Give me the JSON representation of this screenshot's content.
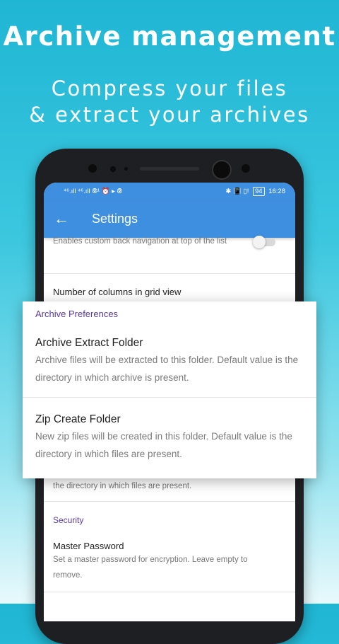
{
  "promo": {
    "headline": "Archive management",
    "subline1": "Compress your files",
    "subline2": "& extract your archives"
  },
  "status_bar": {
    "left_icons": "⁴⁶.ıll ⁴⁶.ıll ⦾¹ ⏰ ▸ ⦾",
    "right_icons": "✱ 📳 ▯!",
    "battery": "94",
    "time": "16:28"
  },
  "app_bar": {
    "back_icon": "←",
    "title": "Settings"
  },
  "settings_background": {
    "partial_summary": "Enables custom back navigation at top of the list",
    "grid_columns_title": "Number of columns in grid view",
    "hidden_summary_tail": "the directory in which files are present.",
    "security_category": "Security",
    "master_password_title": "Master Password",
    "master_password_summary": "Set a master password for encryption. Leave empty to remove."
  },
  "archive_card": {
    "category": "Archive Preferences",
    "extract_title": "Archive Extract Folder",
    "extract_summary": "Archive files will be extracted to this folder. Default value is the directory in which archive is present.",
    "zip_title": "Zip Create Folder",
    "zip_summary": "New zip files will be created in this folder. Default value is the directory in which files are present."
  },
  "colors": {
    "primary": "#3f8fe0",
    "category": "#5b3b9c",
    "background_top": "#1fb6d4"
  }
}
